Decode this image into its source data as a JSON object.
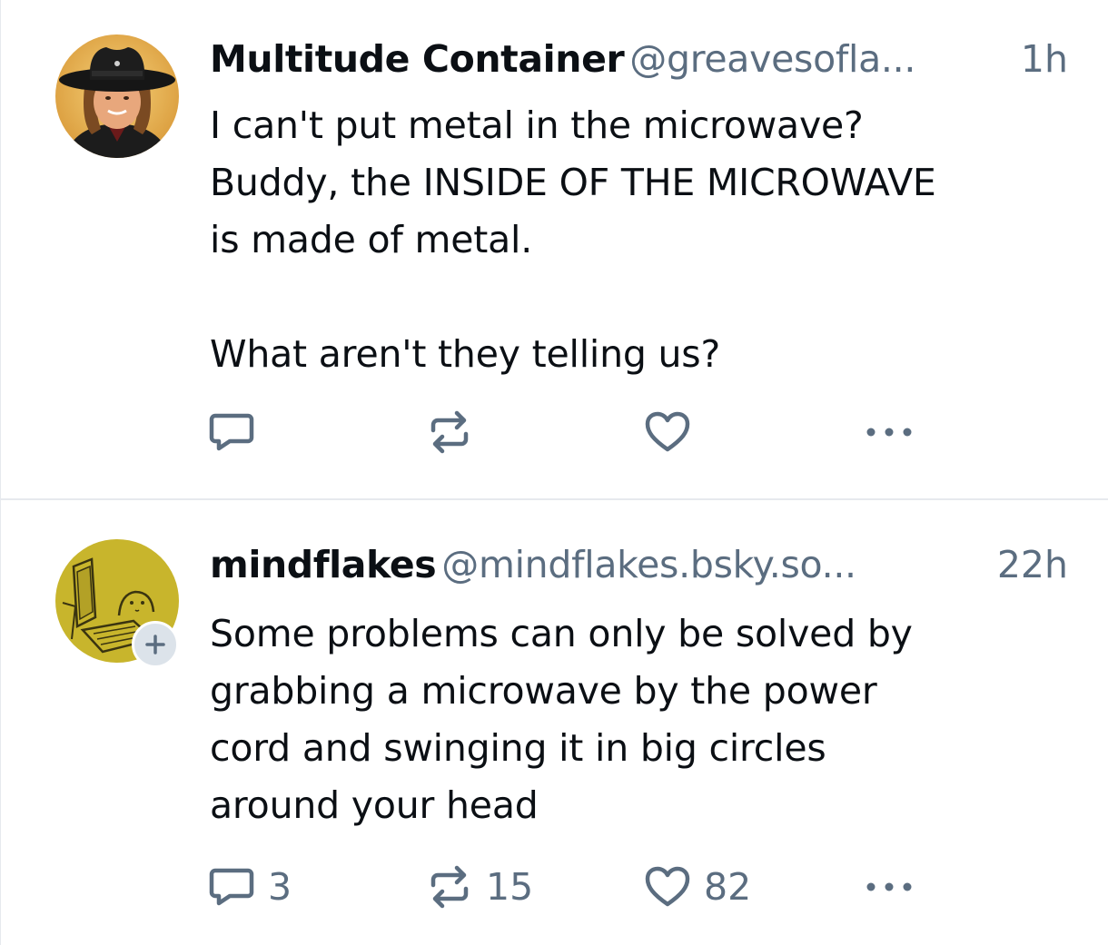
{
  "colors": {
    "text": "#0b0f14",
    "muted": "#5b6d80",
    "divider": "#e6e9ee",
    "badge_bg": "#dce3ea"
  },
  "posts": [
    {
      "display_name": "Multitude Container",
      "handle": "@greavesofla...",
      "time": "1h",
      "text": "I can't put metal in the microwave?\nBuddy, the INSIDE OF THE MICROWAVE\nis made of metal.\n\nWhat aren't they telling us?",
      "avatar_icon": "cowboy-hat-avatar",
      "reply_count": "",
      "repost_count": "",
      "like_count": ""
    },
    {
      "display_name": "mindflakes",
      "handle": "@mindflakes.bsky.so...",
      "time": "22h",
      "text": "Some problems can only be solved by\ngrabbing a microwave by the power\ncord and swinging it in big circles\naround your head",
      "avatar_icon": "cartoon-computer-avatar",
      "follow_badge": "+",
      "reply_count": "3",
      "repost_count": "15",
      "like_count": "82"
    }
  ]
}
